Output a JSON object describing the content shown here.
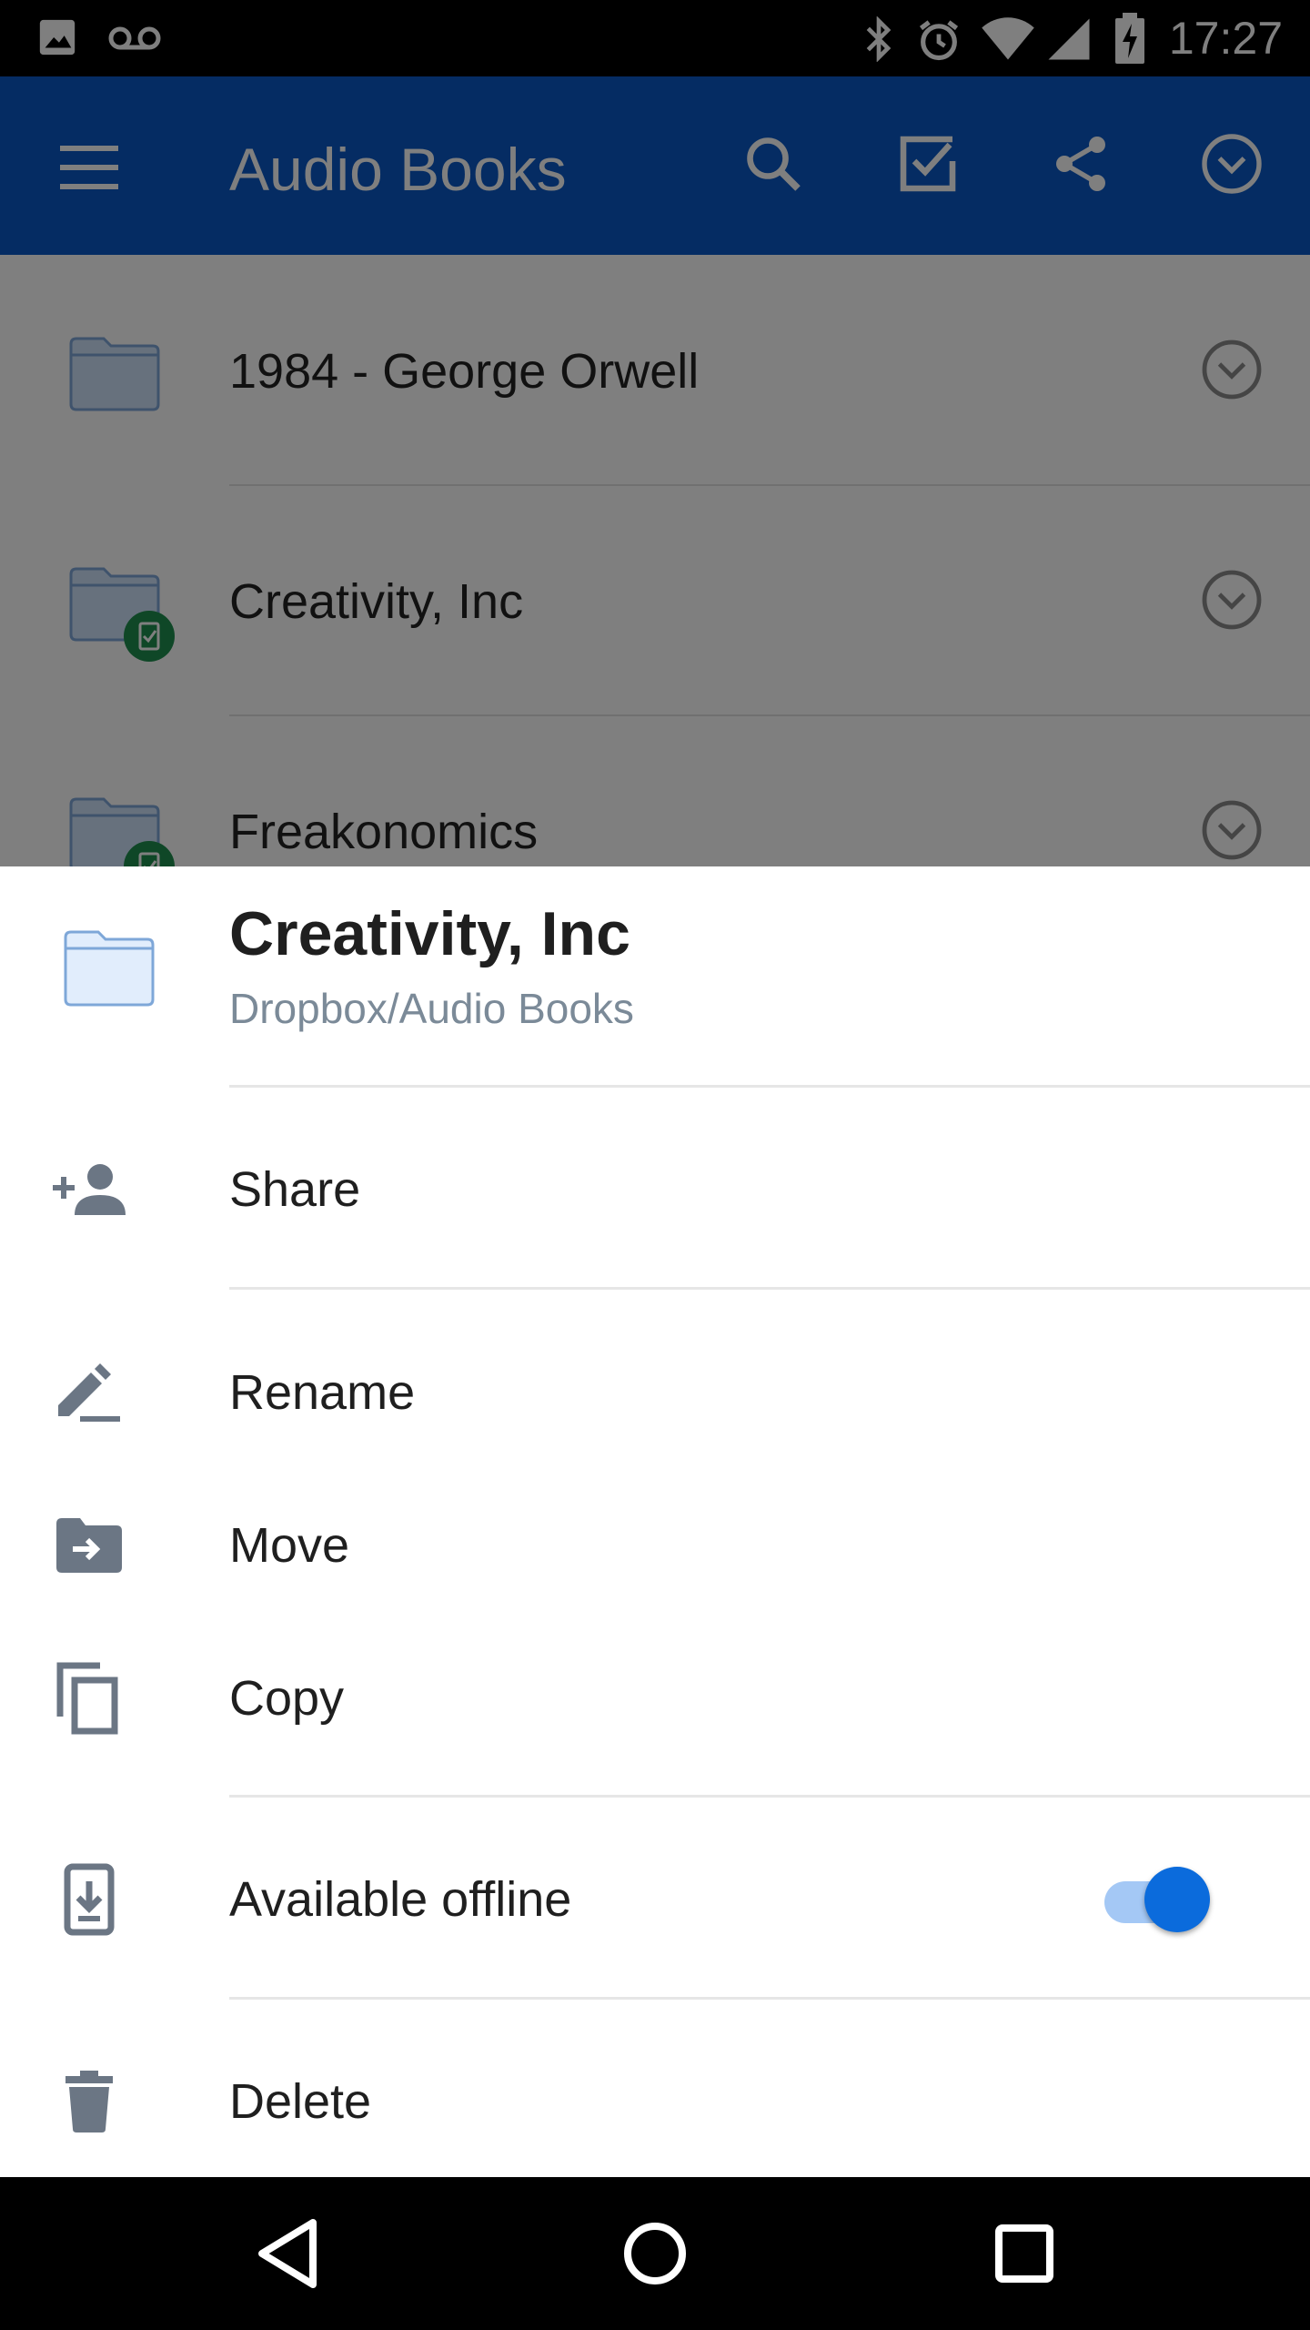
{
  "status_bar": {
    "time": "17:27",
    "icons": [
      "image-icon",
      "voicemail-icon",
      "bluetooth-icon",
      "alarm-icon",
      "wifi-icon",
      "signal-icon",
      "battery-charging-icon"
    ]
  },
  "app_bar": {
    "title": "Audio Books",
    "actions": [
      "menu-icon",
      "search-icon",
      "select-icon",
      "share-icon",
      "more-icon"
    ]
  },
  "file_list": {
    "items": [
      {
        "name": "1984 - George Orwell",
        "offline": false
      },
      {
        "name": "Creativity, Inc",
        "offline": true
      },
      {
        "name": "Freakonomics",
        "offline": true
      }
    ]
  },
  "sheet": {
    "title": "Creativity, Inc",
    "path": "Dropbox/Audio Books",
    "actions": {
      "share": "Share",
      "rename": "Rename",
      "move": "Move",
      "copy": "Copy",
      "available_offline": "Available offline",
      "delete": "Delete"
    },
    "available_offline_on": true
  },
  "colors": {
    "app_bar": "#0a59c6",
    "accent": "#0b6bdc",
    "icon_gray": "#6b7684",
    "folder": "#cfe2fa",
    "offline_badge": "#1e8f4e"
  }
}
